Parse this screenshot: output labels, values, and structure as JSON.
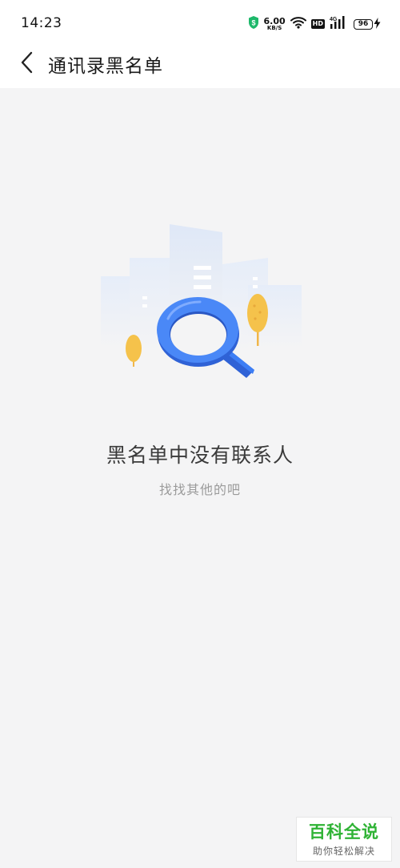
{
  "status_bar": {
    "time": "14:23",
    "net_speed_value": "6.00",
    "net_speed_unit": "KB/S",
    "hd_label": "HD",
    "signal_label": "4G",
    "battery_level": "96"
  },
  "nav": {
    "title": "通讯录黑名单",
    "back_icon": "chevron-left-icon"
  },
  "empty_state": {
    "title": "黑名单中没有联系人",
    "subtitle": "找找其他的吧",
    "illustration_icon": "search-city-illustration"
  },
  "watermark": {
    "title": "百科全说",
    "subtitle": "助你轻松解决"
  },
  "colors": {
    "accent_blue": "#3d7ef5",
    "tree_yellow": "#f5c24b",
    "background": "#f4f4f5",
    "watermark_green": "#2fb335"
  }
}
